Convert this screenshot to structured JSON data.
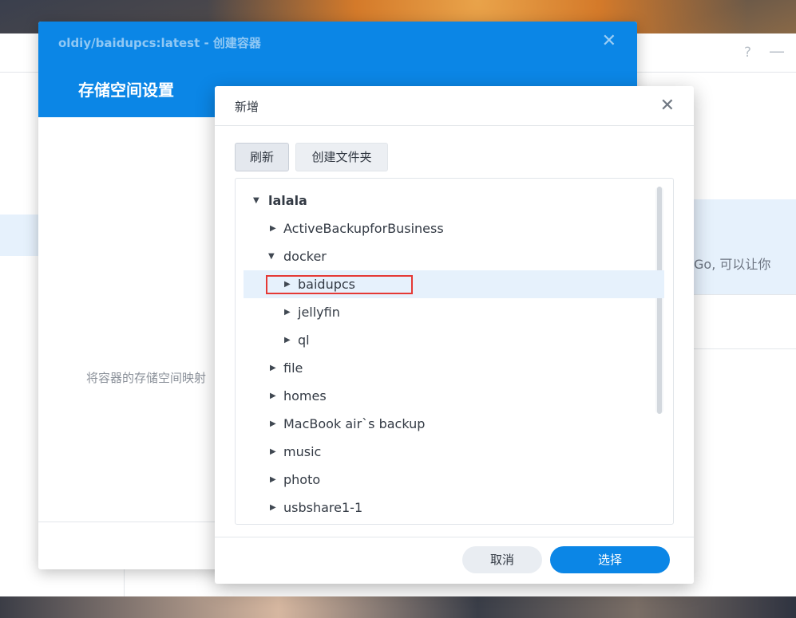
{
  "background_window": {
    "help_icon": "question-icon",
    "minimize_icon": "minimize-icon",
    "description_text": "Go, 可以让你"
  },
  "wizard": {
    "title": "oldiy/baidupcs:latest - 创建容器",
    "step_title": "存储空间设置",
    "description": "将容器的存储空间映射",
    "close_icon": "close-icon"
  },
  "dialog": {
    "title": "新增",
    "close_icon": "close-icon",
    "toolbar": {
      "refresh_label": "刷新",
      "create_folder_label": "创建文件夹"
    },
    "tree": {
      "root": "lalala",
      "items": [
        {
          "label": "ActiveBackupforBusiness",
          "expanded": false
        },
        {
          "label": "docker",
          "expanded": true
        },
        {
          "label": "baidupcs",
          "expanded": false,
          "selected": true
        },
        {
          "label": "jellyfin",
          "expanded": false
        },
        {
          "label": "ql",
          "expanded": false
        },
        {
          "label": "file",
          "expanded": false
        },
        {
          "label": "homes",
          "expanded": false
        },
        {
          "label": "MacBook air`s backup",
          "expanded": false
        },
        {
          "label": "music",
          "expanded": false
        },
        {
          "label": "photo",
          "expanded": false
        },
        {
          "label": "usbshare1-1",
          "expanded": false
        }
      ]
    },
    "cancel_label": "取消",
    "select_label": "选择"
  },
  "colors": {
    "accent": "#0b86e6",
    "selection": "#e6f1fc",
    "highlight": "#e53935"
  }
}
